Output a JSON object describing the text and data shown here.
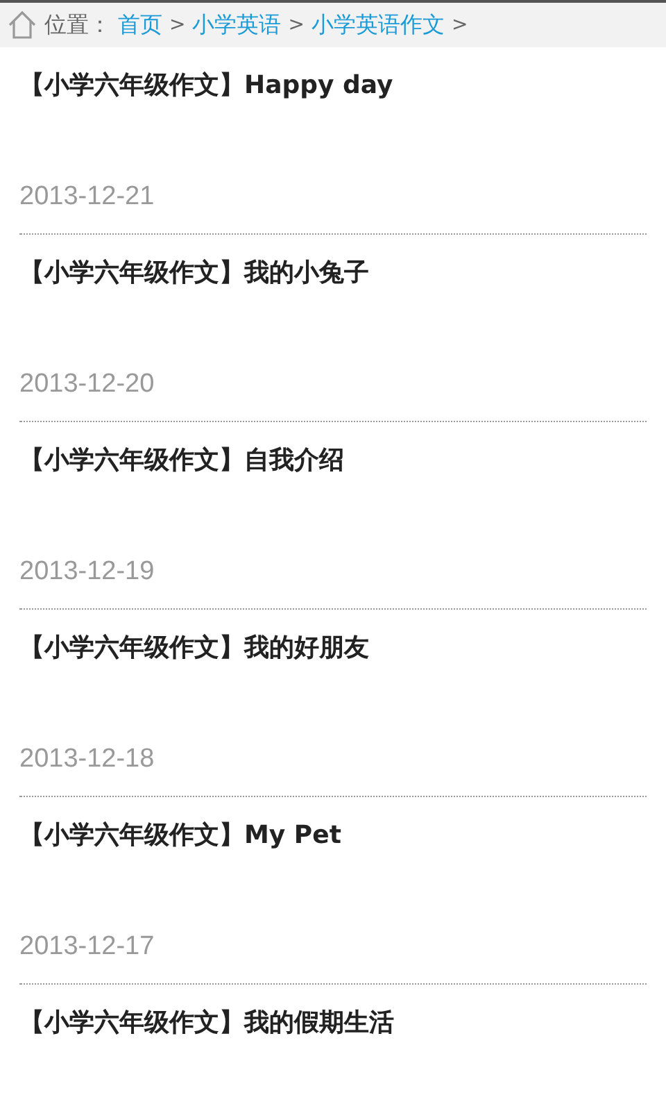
{
  "breadcrumb": {
    "label": "位置：",
    "links": [
      "首页",
      "小学英语",
      "小学英语作文"
    ],
    "separator": ">"
  },
  "articles": [
    {
      "title": "【小学六年级作文】Happy day",
      "date": "2013-12-21"
    },
    {
      "title": "【小学六年级作文】我的小兔子",
      "date": "2013-12-20"
    },
    {
      "title": "【小学六年级作文】自我介绍",
      "date": "2013-12-19"
    },
    {
      "title": "【小学六年级作文】我的好朋友",
      "date": "2013-12-18"
    },
    {
      "title": "【小学六年级作文】My Pet",
      "date": "2013-12-17"
    },
    {
      "title": "【小学六年级作文】我的假期生活"
    }
  ]
}
